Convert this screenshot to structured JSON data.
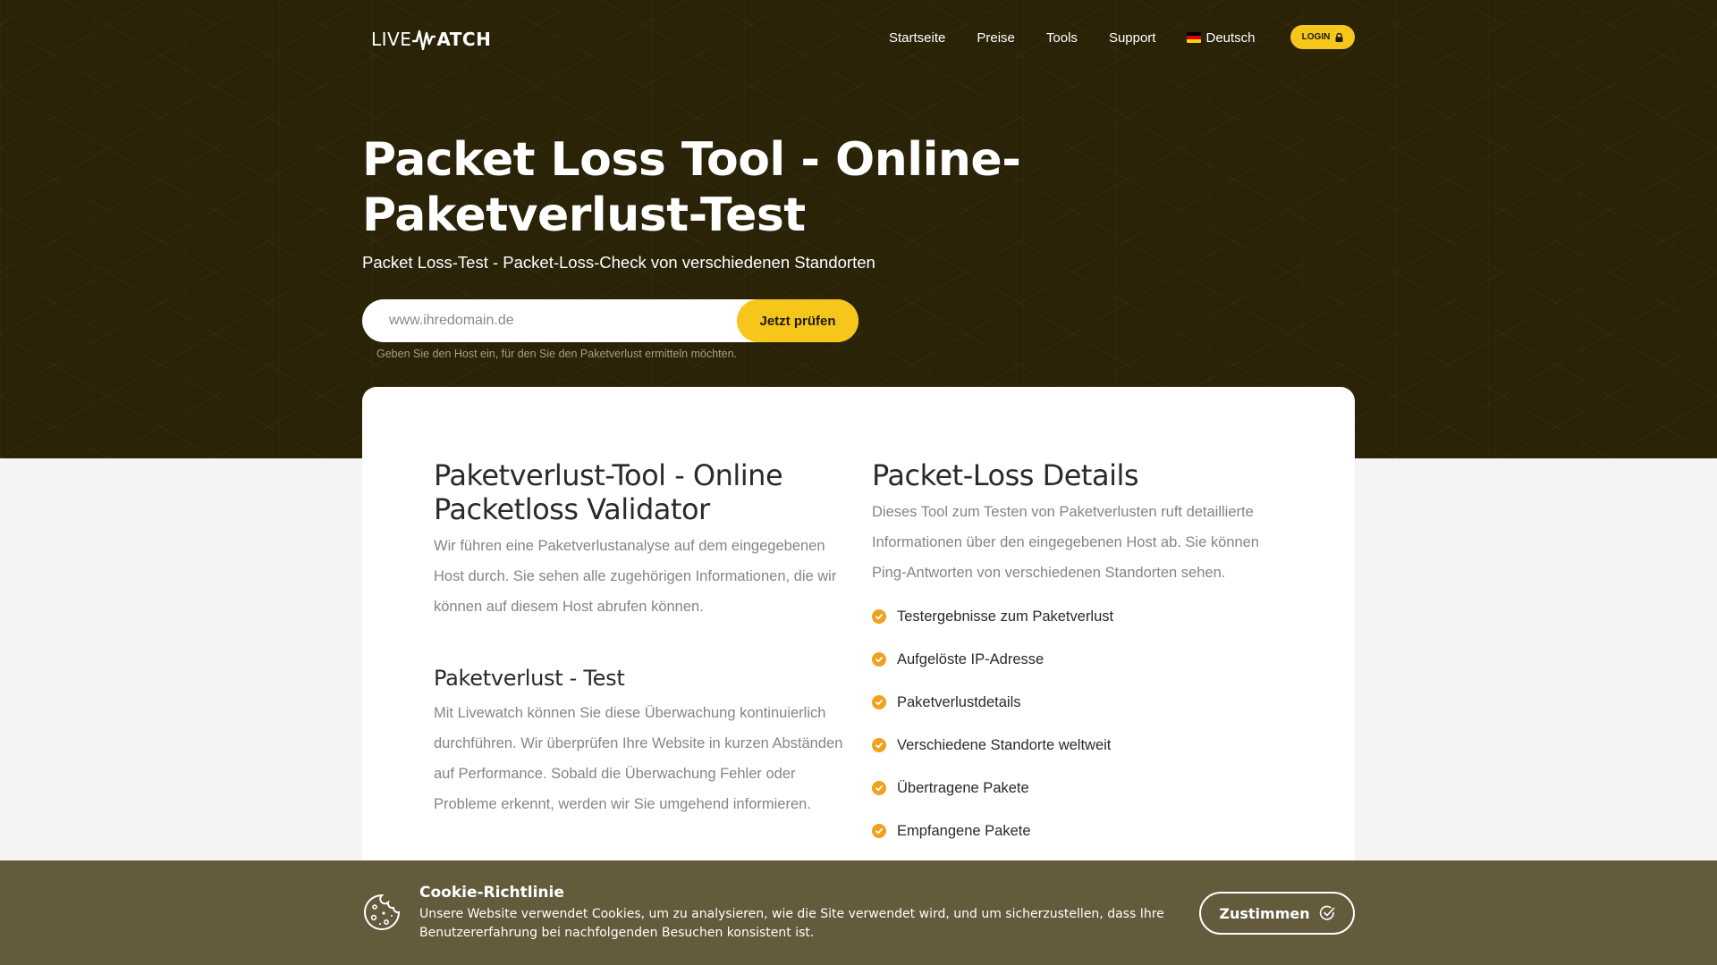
{
  "logo": {
    "part1": "LIVE",
    "part2": "ATCH"
  },
  "nav": {
    "items": [
      {
        "label": "Startseite"
      },
      {
        "label": "Preise"
      },
      {
        "label": "Tools"
      },
      {
        "label": "Support"
      }
    ],
    "language": "Deutsch",
    "login": "LOGIN"
  },
  "hero": {
    "title": "Packet Loss Tool - Online-Paketverlust-Test",
    "subtitle": "Packet Loss-Test - Packet-Loss-Check von verschiedenen Standorten",
    "search": {
      "placeholder": "www.ihredomain.de",
      "value": "",
      "button": "Jetzt prüfen",
      "hint": "Geben Sie den Host ein, für den Sie den Paketverlust ermitteln möchten."
    }
  },
  "content": {
    "left": {
      "heading": "Paketverlust-Tool - Online Packetloss Validator",
      "text": "Wir führen eine Paketverlustanalyse auf dem eingegebenen Host durch. Sie sehen alle zugehörigen Informationen, die wir können auf diesem Host abrufen können.",
      "section2_heading": "Paketverlust - Test",
      "section2_text": "Mit Livewatch können Sie diese Überwachung kontinuierlich durchführen. Wir überprüfen Ihre Website in kurzen Abständen auf Performance. Sobald die Überwachung Fehler oder Probleme erkennt, werden wir Sie umgehend informieren."
    },
    "right": {
      "heading": "Packet-Loss Details",
      "text": "Dieses Tool zum Testen von Paketverlusten ruft detaillierte Informationen über den eingegebenen Host ab. Sie können Ping-Antworten von verschiedenen Standorten sehen.",
      "features": [
        "Testergebnisse zum Paketverlust",
        "Aufgelöste IP-Adresse",
        "Paketverlustdetails",
        "Verschiedene Standorte weltweit",
        "Übertragene Pakete",
        "Empfangene Pakete"
      ]
    }
  },
  "cookie": {
    "title": "Cookie-Richtlinie",
    "text": "Unsere Website verwendet Cookies, um zu analysieren, wie die Site verwendet wird, und um sicherzustellen, dass Ihre Benutzererfahrung bei nachfolgenden Besuchen konsistent ist.",
    "button": "Zustimmen"
  },
  "colors": {
    "hero_bg": "#2a2308",
    "accent": "#f6c61a",
    "check": "#f0a21c",
    "cookie_bg": "#645a3c",
    "page_bg": "#f4f4f4"
  },
  "icons": [
    "logo-wave-icon",
    "flag-de-icon",
    "lock-icon",
    "check-circle-icon",
    "cookie-icon",
    "check-outline-icon"
  ]
}
